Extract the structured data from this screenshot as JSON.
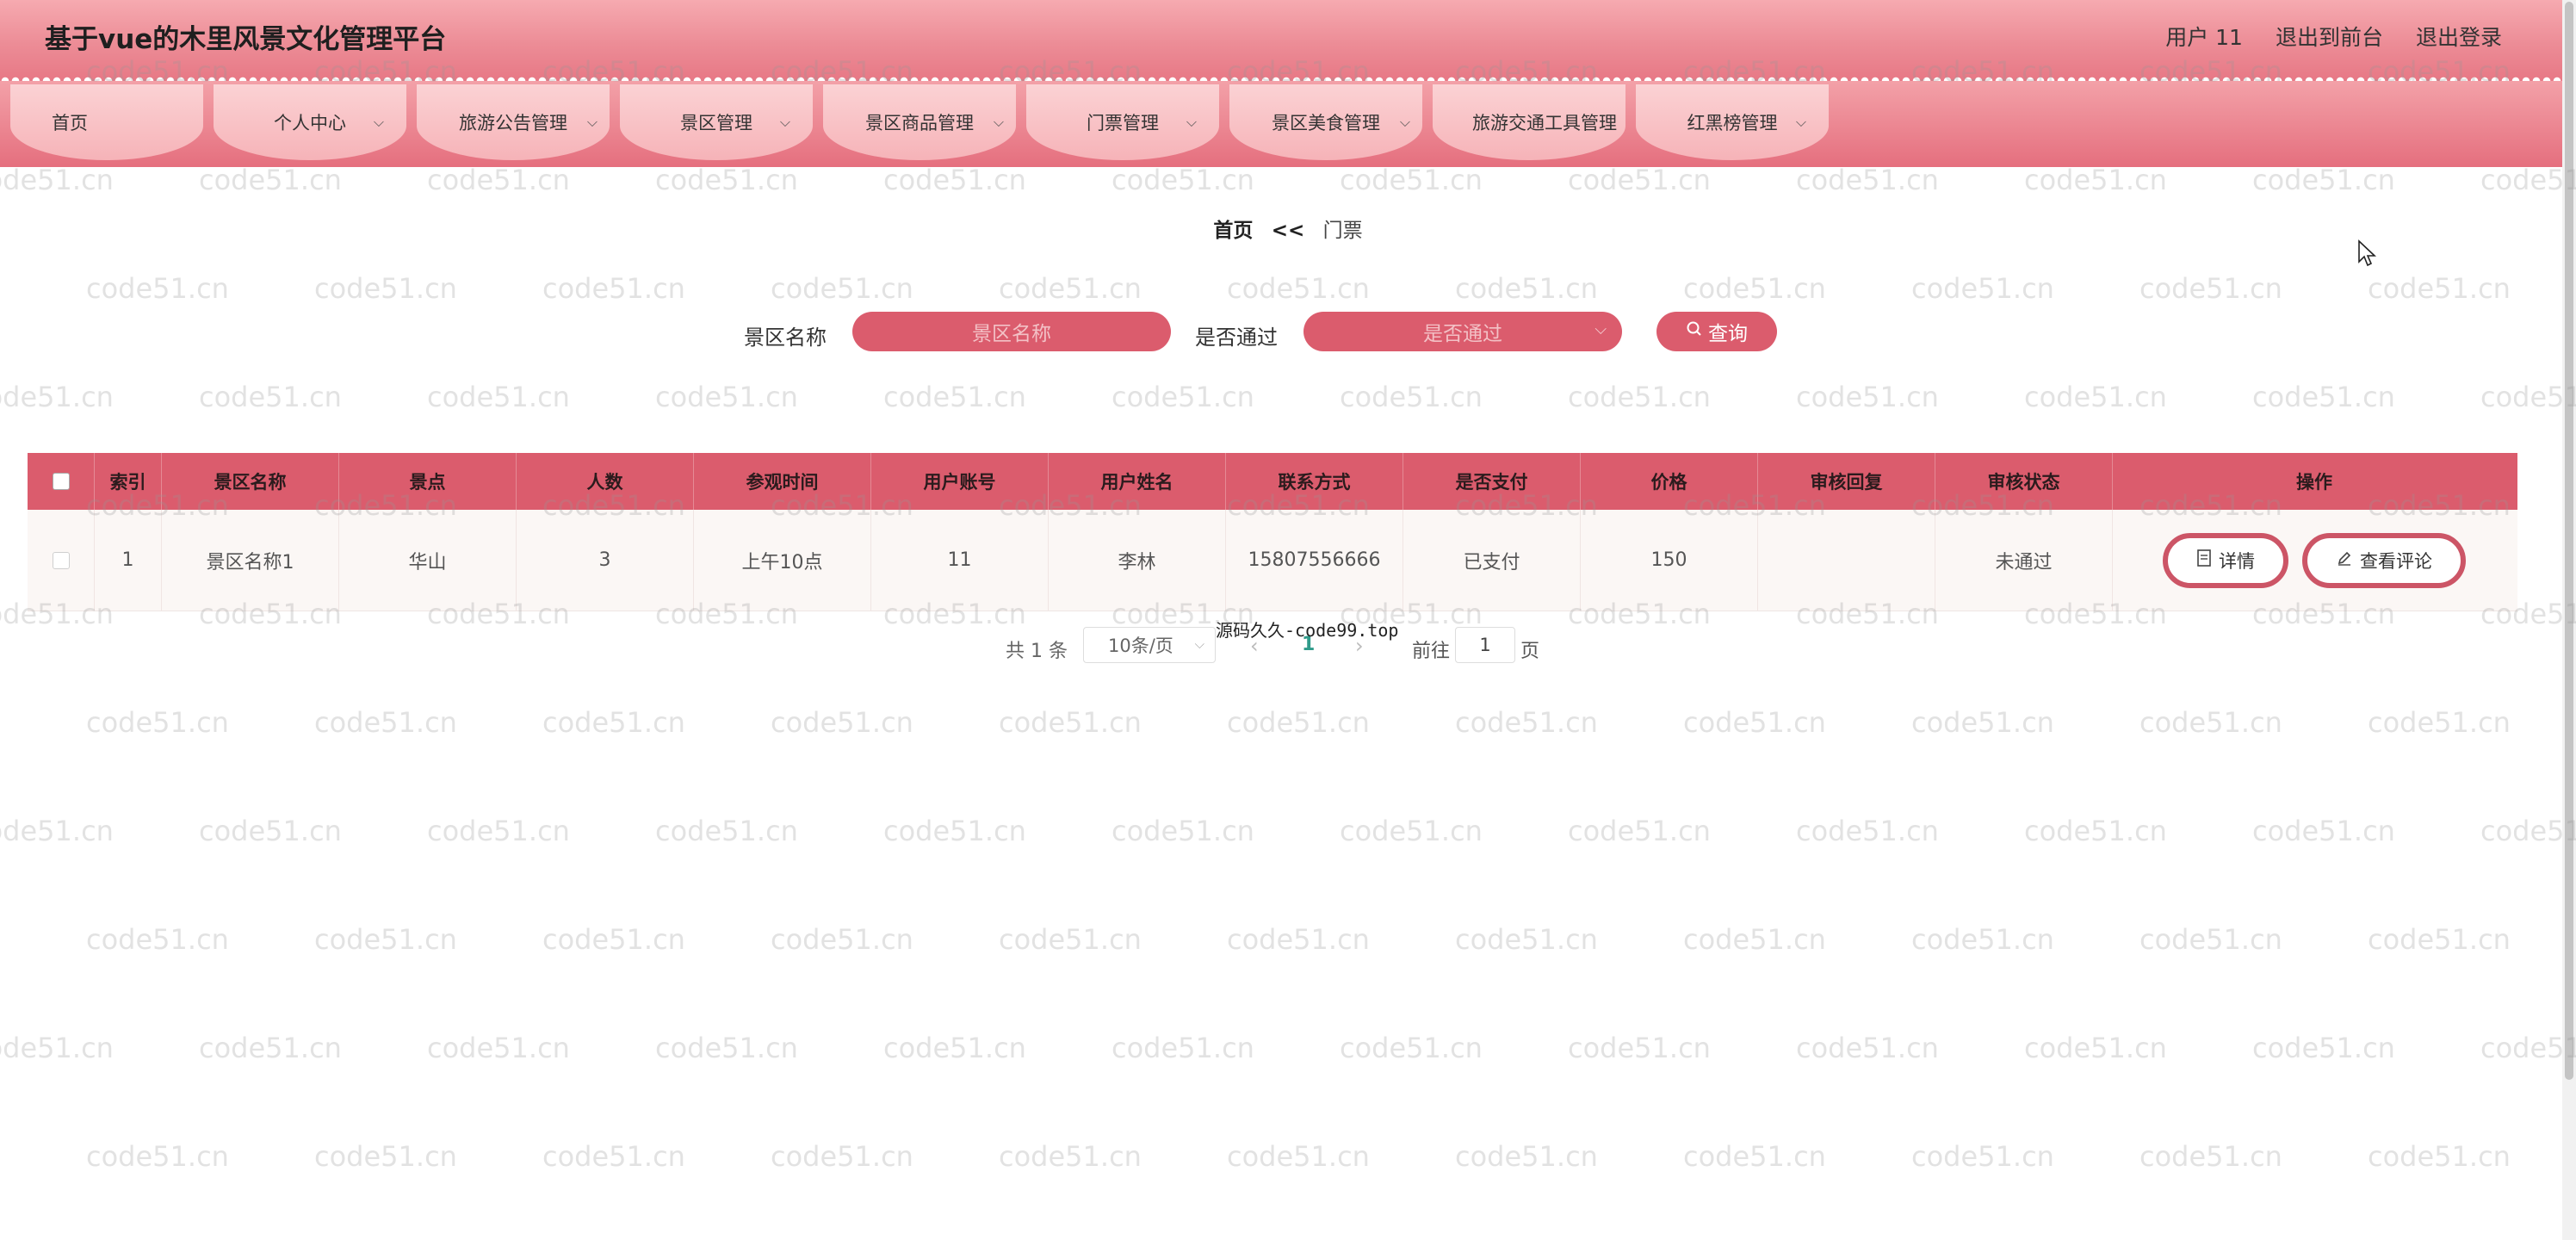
{
  "header": {
    "title": "基于vue的木里风景文化管理平台",
    "user_label": "用户 11",
    "back_to_front": "退出到前台",
    "logout": "退出登录"
  },
  "nav": {
    "items": [
      {
        "label": "首页",
        "has_dropdown": false
      },
      {
        "label": "个人中心",
        "has_dropdown": true
      },
      {
        "label": "旅游公告管理",
        "has_dropdown": true
      },
      {
        "label": "景区管理",
        "has_dropdown": true
      },
      {
        "label": "景区商品管理",
        "has_dropdown": true
      },
      {
        "label": "门票管理",
        "has_dropdown": true
      },
      {
        "label": "景区美食管理",
        "has_dropdown": true
      },
      {
        "label": "旅游交通工具管理",
        "has_dropdown": false
      },
      {
        "label": "红黑榜管理",
        "has_dropdown": true
      }
    ]
  },
  "breadcrumb": {
    "home": "首页",
    "separator": "<<",
    "current": "门票"
  },
  "search": {
    "scenic_name_label": "景区名称",
    "scenic_name_placeholder": "景区名称",
    "passed_label": "是否通过",
    "passed_placeholder": "是否通过",
    "query_button": "查询"
  },
  "table": {
    "columns": [
      "索引",
      "景区名称",
      "景点",
      "人数",
      "参观时间",
      "用户账号",
      "用户姓名",
      "联系方式",
      "是否支付",
      "价格",
      "审核回复",
      "审核状态",
      "操作"
    ],
    "rows": [
      {
        "index": "1",
        "scenic_name": "景区名称1",
        "spot": "华山",
        "people": "3",
        "visit_time": "上午10点",
        "account": "11",
        "user_name": "李林",
        "contact": "15807556666",
        "paid": "已支付",
        "price": "150",
        "review_reply": "",
        "review_status": "未通过",
        "actions": [
          "详情",
          "查看评论"
        ]
      }
    ]
  },
  "pagination": {
    "total": "共 1 条",
    "page_size": "10条/页",
    "current_page": "1",
    "goto_label": "前往",
    "goto_value": "1",
    "page_suffix": "页"
  },
  "overlay_text": "源码久久-code99.top",
  "watermark_text": "code51.cn",
  "colors": {
    "primary": "#db5c6d",
    "header_gradient_top": "#f6aab0",
    "header_gradient_bottom": "#e77885",
    "nav_item": "#f9c4c8",
    "active_page": "#2f9b8a"
  }
}
